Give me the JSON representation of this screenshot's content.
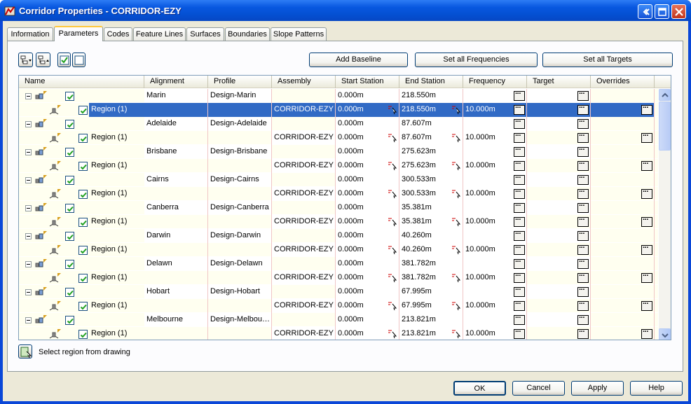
{
  "window": {
    "title": "Corridor Properties - CORRIDOR-EZY"
  },
  "titlebar_icons": [
    "app-icon",
    "restore-icon",
    "maximize-icon",
    "close-icon"
  ],
  "tabs": [
    {
      "label": "Information"
    },
    {
      "label": "Parameters",
      "active": true
    },
    {
      "label": "Codes"
    },
    {
      "label": "Feature Lines"
    },
    {
      "label": "Surfaces"
    },
    {
      "label": "Boundaries"
    },
    {
      "label": "Slope Patterns"
    }
  ],
  "toolbar": {
    "icons": [
      "expand-dropdown-icon",
      "collapse-icon",
      "check-all-icon",
      "uncheck-all-icon"
    ],
    "add_baseline": "Add Baseline",
    "set_all_frequencies": "Set all Frequencies",
    "set_all_targets": "Set all Targets"
  },
  "columns": [
    "Name",
    "Alignment",
    "Profile",
    "Assembly",
    "Start Station",
    "End Station",
    "Frequency",
    "Target",
    "Overrides"
  ],
  "baselines": [
    {
      "alignment": "Marin",
      "profile": "Design-Marin",
      "start": "0.000m",
      "end": "218.550m",
      "region": {
        "name": "Region (1)",
        "assembly": "CORRIDOR-EZY",
        "start": "0.000m",
        "end": "218.550m",
        "frequency": "10.000m",
        "selected": true
      }
    },
    {
      "alignment": "Adelaide",
      "profile": "Design-Adelaide",
      "start": "0.000m",
      "end": "87.607m",
      "region": {
        "name": "Region (1)",
        "assembly": "CORRIDOR-EZY",
        "start": "0.000m",
        "end": "87.607m",
        "frequency": "10.000m"
      }
    },
    {
      "alignment": "Brisbane",
      "profile": "Design-Brisbane",
      "start": "0.000m",
      "end": "275.623m",
      "region": {
        "name": "Region (1)",
        "assembly": "CORRIDOR-EZY",
        "start": "0.000m",
        "end": "275.623m",
        "frequency": "10.000m"
      }
    },
    {
      "alignment": "Cairns",
      "profile": "Design-Cairns",
      "start": "0.000m",
      "end": "300.533m",
      "region": {
        "name": "Region (1)",
        "assembly": "CORRIDOR-EZY",
        "start": "0.000m",
        "end": "300.533m",
        "frequency": "10.000m"
      }
    },
    {
      "alignment": "Canberra",
      "profile": "Design-Canberra",
      "start": "0.000m",
      "end": "35.381m",
      "region": {
        "name": "Region (1)",
        "assembly": "CORRIDOR-EZY",
        "start": "0.000m",
        "end": "35.381m",
        "frequency": "10.000m"
      }
    },
    {
      "alignment": "Darwin",
      "profile": "Design-Darwin",
      "start": "0.000m",
      "end": "40.260m",
      "region": {
        "name": "Region (1)",
        "assembly": "CORRIDOR-EZY",
        "start": "0.000m",
        "end": "40.260m",
        "frequency": "10.000m"
      }
    },
    {
      "alignment": "Delawn",
      "profile": "Design-Delawn",
      "start": "0.000m",
      "end": "381.782m",
      "region": {
        "name": "Region (1)",
        "assembly": "CORRIDOR-EZY",
        "start": "0.000m",
        "end": "381.782m",
        "frequency": "10.000m"
      }
    },
    {
      "alignment": "Hobart",
      "profile": "Design-Hobart",
      "start": "0.000m",
      "end": "67.995m",
      "region": {
        "name": "Region (1)",
        "assembly": "CORRIDOR-EZY",
        "start": "0.000m",
        "end": "67.995m",
        "frequency": "10.000m"
      }
    },
    {
      "alignment": "Melbourne",
      "profile": "Design-Melbou…",
      "start": "0.000m",
      "end": "213.821m",
      "region": {
        "name": "Region (1)",
        "assembly": "CORRIDOR-EZY",
        "start": "0.000m",
        "end": "213.821m",
        "frequency": "10.000m"
      }
    }
  ],
  "pick_region": {
    "label": "Select region from drawing"
  },
  "footer": {
    "ok": "OK",
    "cancel": "Cancel",
    "apply": "Apply",
    "help": "Help"
  },
  "colors": {
    "titlebar": "#0857e0",
    "selection": "#316ac5",
    "face": "#ece9d8",
    "region_row": "#fffff0"
  }
}
